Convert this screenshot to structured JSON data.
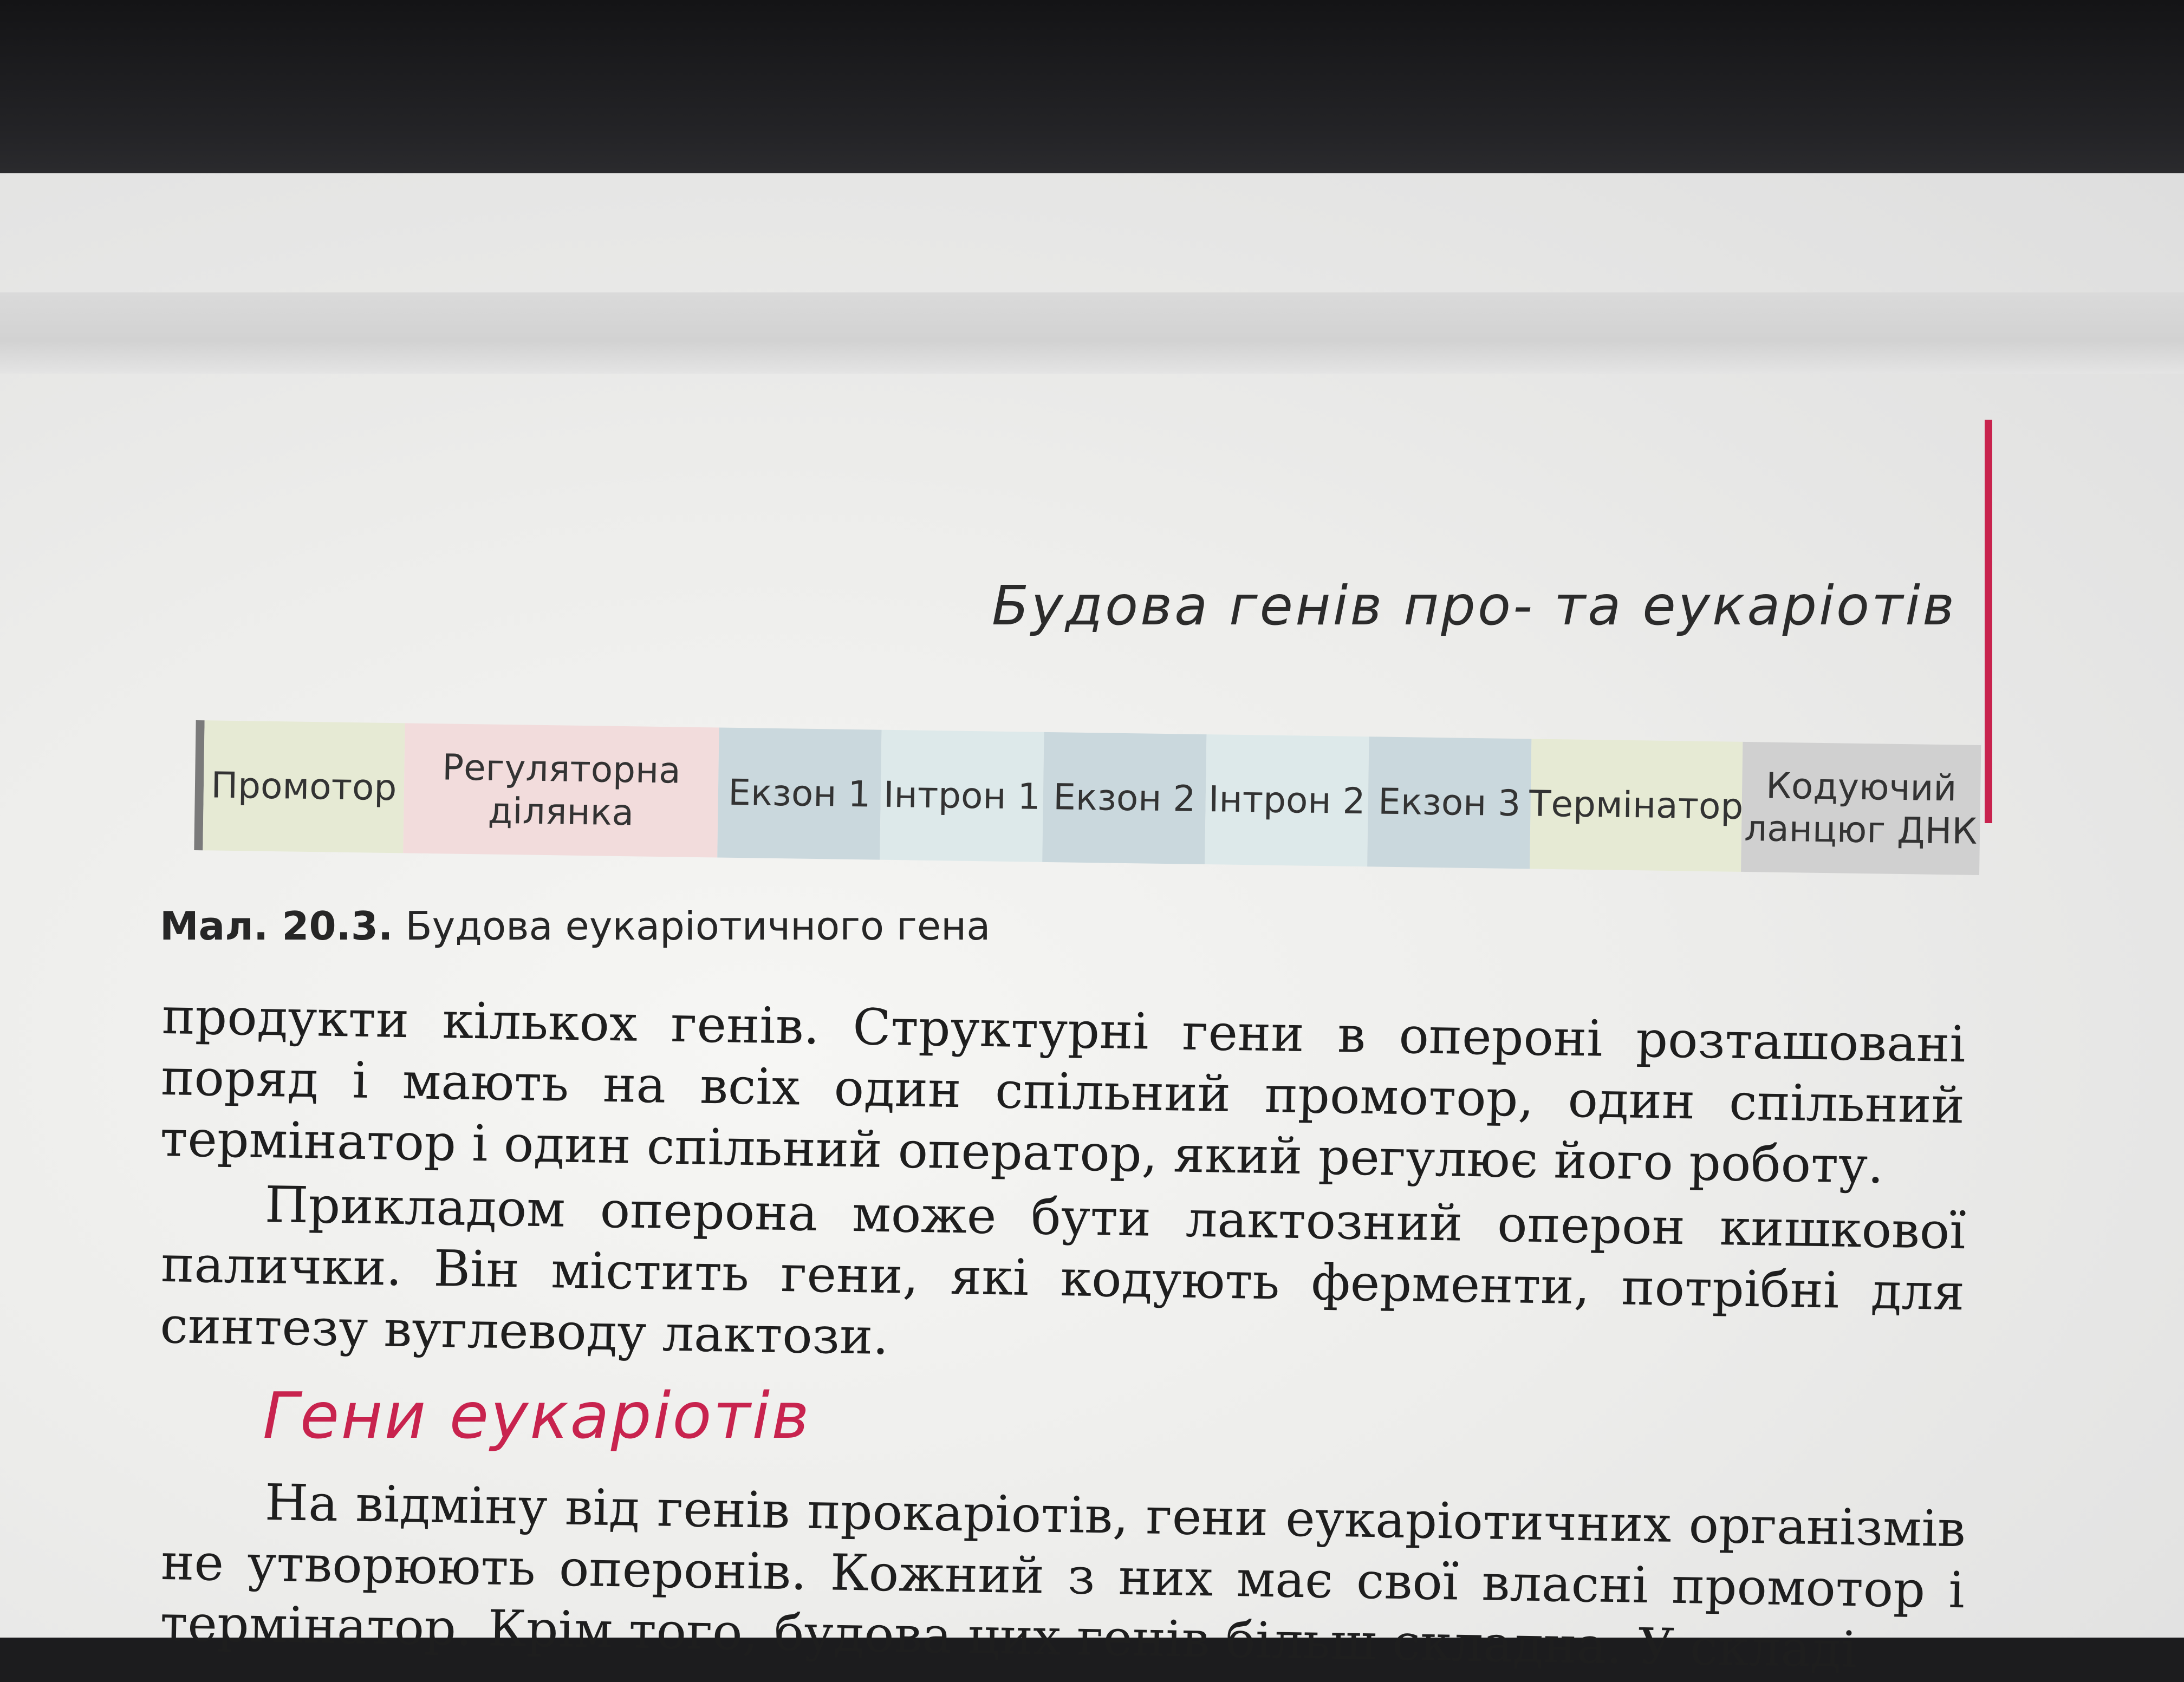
{
  "running_head": "Будова генів про- та еукаріотів",
  "accent_color": "#c8234e",
  "gene_diagram": {
    "segments": [
      {
        "label": "Промотор",
        "color": "#e6ead4"
      },
      {
        "label": "Регуляторна ділянка",
        "color": "#f2dcdc"
      },
      {
        "label": "Екзон 1",
        "color": "#cad8dd"
      },
      {
        "label": "Інтрон 1",
        "color": "#dde9ea"
      },
      {
        "label": "Екзон 2",
        "color": "#cad8dd"
      },
      {
        "label": "Інтрон 2",
        "color": "#dde9ea"
      },
      {
        "label": "Екзон 3",
        "color": "#cad8dd"
      },
      {
        "label": "Термінатор",
        "color": "#e6ead4"
      },
      {
        "label": "Кодуючий ланцюг ДНК",
        "color": "#d0d0d0"
      }
    ]
  },
  "caption": {
    "number": "Мал. 20.3.",
    "text": "Будова еукаріотичного гена"
  },
  "paragraphs": [
    "продукти кількох генів. Структурні гени в опероні розташовані поряд і мають на всіх один спільний промотор, один спільний термінатор і один спільний оператор, який регулює його роботу.",
    "Прикладом оперона може бути лактозний оперон кишкової палички. Він містить гени, які кодують ферменти, потрібні для синтезу вуглеводу лактози."
  ],
  "section_heading": "Гени еукаріотів",
  "section_paragraph": "На відміну від генів прокаріотів, гени еукаріотичних організмів не утворюють оперонів. Кожний з них має свої власні промотор і термінатор. Крім того, будова цих генів більш складна. У складі"
}
